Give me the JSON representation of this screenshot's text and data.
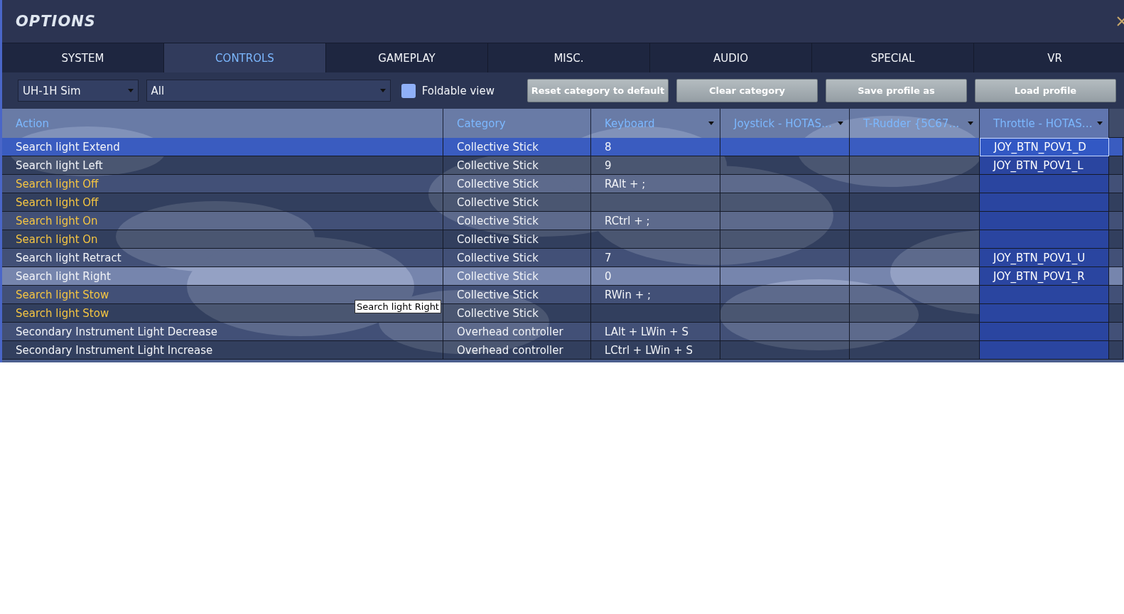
{
  "window": {
    "title": "OPTIONS"
  },
  "tabs": [
    {
      "label": "SYSTEM",
      "selected": false
    },
    {
      "label": "CONTROLS",
      "selected": true
    },
    {
      "label": "GAMEPLAY",
      "selected": false
    },
    {
      "label": "MISC.",
      "selected": false
    },
    {
      "label": "AUDIO",
      "selected": false
    },
    {
      "label": "SPECIAL",
      "selected": false
    },
    {
      "label": "VR",
      "selected": false
    }
  ],
  "toolbar": {
    "aircraft": "UH-1H Sim",
    "category": "All",
    "foldable": {
      "label": "Foldable view",
      "checked": false
    },
    "buttons": [
      "Reset category to default",
      "Clear category",
      "Save profile as",
      "Load profile"
    ]
  },
  "table": {
    "columns": [
      {
        "label": "Action",
        "menu": false,
        "selected": false
      },
      {
        "label": "Category",
        "menu": false,
        "selected": false
      },
      {
        "label": "Keyboard",
        "menu": true,
        "selected": false
      },
      {
        "label": "Joystick - HOTAS…",
        "menu": true,
        "selected": false
      },
      {
        "label": "T-Rudder {5C67…",
        "menu": true,
        "selected": false
      },
      {
        "label": "Throttle - HOTAS…",
        "menu": true,
        "selected": true
      }
    ],
    "rows": [
      {
        "action": "Search light Extend",
        "category": "Collective Stick",
        "keyboard": "8",
        "throttle": "JOY_BTN_POV1_D",
        "changed": false,
        "selected": true,
        "hovered": false
      },
      {
        "action": "Search light Left",
        "category": "Collective Stick",
        "keyboard": "9",
        "throttle": "JOY_BTN_POV1_L",
        "changed": false,
        "selected": false,
        "hovered": false
      },
      {
        "action": "Search light Off",
        "category": "Collective Stick",
        "keyboard": "RAlt + ;",
        "changed": true,
        "selected": false,
        "hovered": false
      },
      {
        "action": "Search light Off",
        "category": "Collective Stick",
        "changed": true,
        "selected": false,
        "hovered": false
      },
      {
        "action": "Search light On",
        "category": "Collective Stick",
        "keyboard": "RCtrl + ;",
        "changed": true,
        "selected": false,
        "hovered": false
      },
      {
        "action": "Search light On",
        "category": "Collective Stick",
        "changed": true,
        "selected": false,
        "hovered": false
      },
      {
        "action": "Search light Retract",
        "category": "Collective Stick",
        "keyboard": "7",
        "throttle": "JOY_BTN_POV1_U",
        "changed": false,
        "selected": false,
        "hovered": false
      },
      {
        "action": "Search light Right",
        "category": "Collective Stick",
        "keyboard": "0",
        "throttle": "JOY_BTN_POV1_R",
        "changed": false,
        "selected": false,
        "hovered": true
      },
      {
        "action": "Search light Stow",
        "category": "Collective Stick",
        "keyboard": "RWin + ;",
        "changed": true,
        "selected": false,
        "hovered": false
      },
      {
        "action": "Search light Stow",
        "category": "Collective Stick",
        "changed": true,
        "selected": false,
        "hovered": false
      },
      {
        "action": "Secondary Instrument Light Decrease",
        "category": "Overhead controller",
        "keyboard": "LAlt + LWin + S",
        "changed": false,
        "selected": false,
        "hovered": false
      },
      {
        "action": "Secondary Instrument Light Increase",
        "category": "Overhead controller",
        "keyboard": "LCtrl + LWin + S",
        "changed": false,
        "selected": false,
        "hovered": false
      }
    ]
  },
  "tooltip": {
    "text": "Search light Right"
  }
}
